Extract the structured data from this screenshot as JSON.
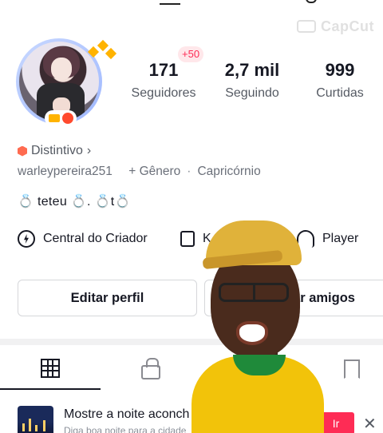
{
  "watermark": {
    "text": "CapCut"
  },
  "profile": {
    "stats": [
      {
        "key": "followers",
        "value": "171",
        "label": "Seguidores"
      },
      {
        "key": "following",
        "value": "2,7 mil",
        "label": "Seguindo"
      },
      {
        "key": "likes",
        "value": "999",
        "label": "Curtidas"
      }
    ],
    "new_followers_badge": "+50",
    "badge_label": "Distintivo",
    "username": "warleypereira251",
    "gender_label": "+ Gênero",
    "zodiac": "Capricórnio",
    "bio": "💍 teteu 💍.   💍t💍"
  },
  "tools": {
    "creator_center": "Central do Criador",
    "shop_partial": "K",
    "player": "Player"
  },
  "buttons": {
    "edit_profile": "Editar perfil",
    "add_friends_partial": "ar amigos"
  },
  "promo": {
    "title": "Mostre a noite aconch",
    "subtitle": "Diga boa noite para a cidade",
    "go_label": "Ir",
    "close_label": "✕"
  },
  "colors": {
    "accent": "#fe2c55",
    "text_primary": "#161823",
    "text_secondary": "#555a63"
  }
}
